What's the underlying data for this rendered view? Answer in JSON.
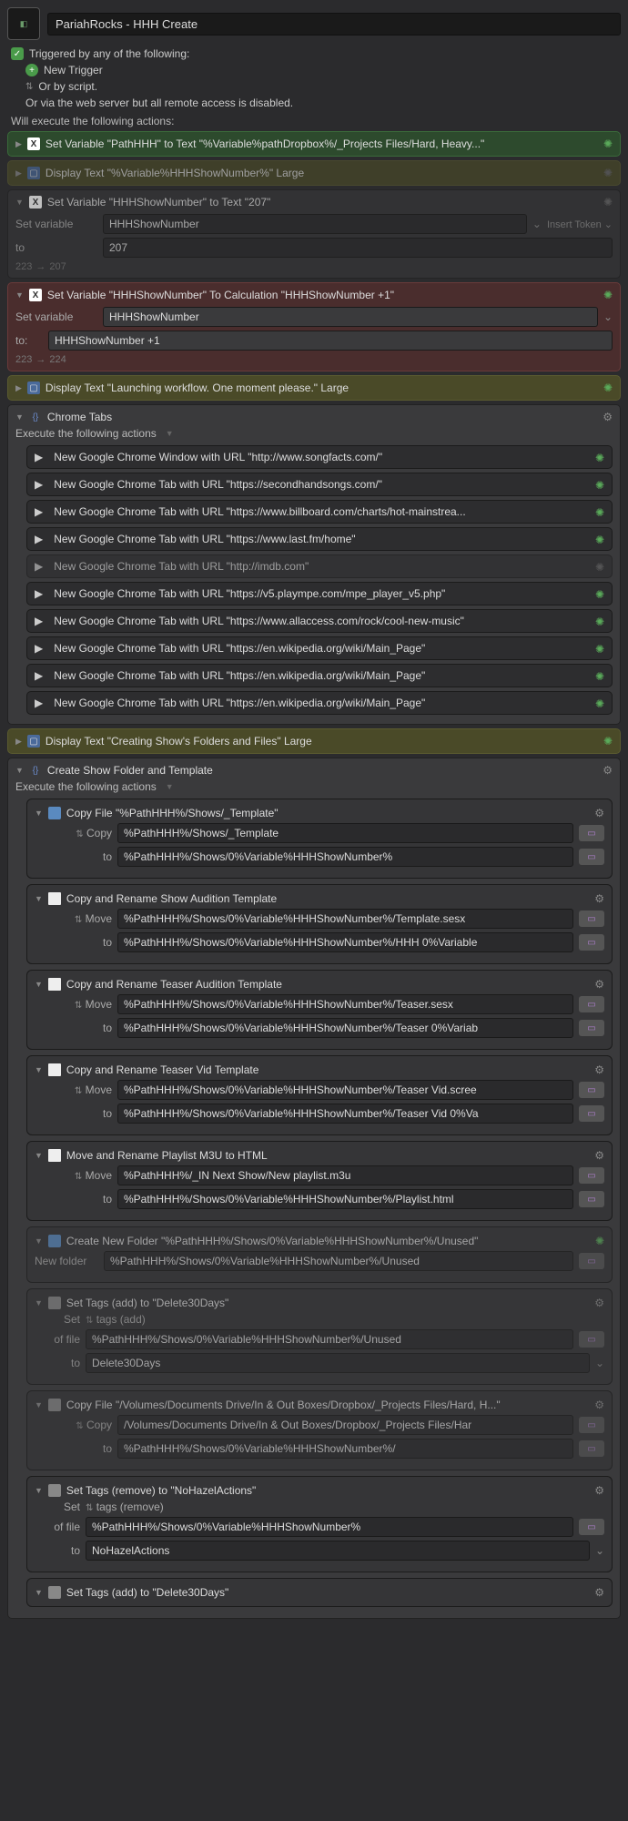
{
  "header": {
    "title": "PariahRocks - HHH Create"
  },
  "trigger": {
    "line": "Triggered by any of the following:",
    "new_trigger": "New Trigger",
    "or_script": "Or by script.",
    "web_server": "Or via the web server but all remote access is disabled."
  },
  "exec_label": "Will execute the following actions:",
  "a1": {
    "text": "Set Variable \"PathHHH\" to Text \"%Variable%pathDropbox%/_Projects Files/Hard, Heavy...\""
  },
  "a2": {
    "text": "Display Text \"%Variable%HHHShowNumber%\" Large"
  },
  "a3": {
    "title": "Set Variable \"HHHShowNumber\" to Text \"207\"",
    "set_var_label": "Set variable",
    "set_var_value": "HHHShowNumber",
    "insert_token": "Insert Token",
    "to_label": "to",
    "to_value": "207",
    "preview_from": "223",
    "preview_to": "207"
  },
  "a4": {
    "title": "Set Variable \"HHHShowNumber\" To Calculation \"HHHShowNumber +1\"",
    "set_var_label": "Set variable",
    "set_var_value": "HHHShowNumber",
    "to_label": "to:",
    "to_value": "HHHShowNumber +1",
    "preview_from": "223",
    "preview_to": "224"
  },
  "a5": {
    "text": "Display Text \"Launching workflow. One moment please.\" Large"
  },
  "chrome": {
    "title": "Chrome Tabs",
    "sub": "Execute the following actions",
    "items": [
      {
        "label": "New Google Chrome Window with URL \"http://www.songfacts.com/\"",
        "dim": false
      },
      {
        "label": "New Google Chrome Tab with URL \"https://secondhandsongs.com/\"",
        "dim": false
      },
      {
        "label": "New Google Chrome Tab with URL \"https://www.billboard.com/charts/hot-mainstrea...",
        "dim": false
      },
      {
        "label": "New Google Chrome Tab with URL \"https://www.last.fm/home\"",
        "dim": false
      },
      {
        "label": "New Google Chrome Tab with URL \"http://imdb.com\"",
        "dim": true
      },
      {
        "label": "New Google Chrome Tab with URL \"https://v5.plaympe.com/mpe_player_v5.php\"",
        "dim": false
      },
      {
        "label": "New Google Chrome Tab with URL \"https://www.allaccess.com/rock/cool-new-music\"",
        "dim": false
      },
      {
        "label": "New Google Chrome Tab with URL \"https://en.wikipedia.org/wiki/Main_Page\"",
        "dim": false
      },
      {
        "label": "New Google Chrome Tab with URL \"https://en.wikipedia.org/wiki/Main_Page\"",
        "dim": false
      },
      {
        "label": "New Google Chrome Tab with URL \"https://en.wikipedia.org/wiki/Main_Page\"",
        "dim": false
      }
    ]
  },
  "a7": {
    "text": "Display Text \"Creating Show's Folders and Files\" Large"
  },
  "folder": {
    "title": "Create Show Folder and Template",
    "sub": "Execute the following actions"
  },
  "f1": {
    "title": "Copy File \"%PathHHH%/Shows/_Template\"",
    "op": "Copy",
    "from": "%PathHHH%/Shows/_Template",
    "to_label": "to",
    "to": "%PathHHH%/Shows/0%Variable%HHHShowNumber%"
  },
  "f2": {
    "title": "Copy and Rename Show Audition Template",
    "op": "Move",
    "from": "%PathHHH%/Shows/0%Variable%HHHShowNumber%/Template.sesx",
    "to_label": "to",
    "to": "%PathHHH%/Shows/0%Variable%HHHShowNumber%/HHH 0%Variable"
  },
  "f3": {
    "title": "Copy and Rename Teaser Audition Template",
    "op": "Move",
    "from": "%PathHHH%/Shows/0%Variable%HHHShowNumber%/Teaser.sesx",
    "to_label": "to",
    "to": "%PathHHH%/Shows/0%Variable%HHHShowNumber%/Teaser 0%Variab"
  },
  "f4": {
    "title": "Copy and Rename Teaser Vid Template",
    "op": "Move",
    "from": "%PathHHH%/Shows/0%Variable%HHHShowNumber%/Teaser Vid.scree",
    "to_label": "to",
    "to": "%PathHHH%/Shows/0%Variable%HHHShowNumber%/Teaser Vid 0%Va"
  },
  "f5": {
    "title": "Move and Rename Playlist M3U to HTML",
    "op": "Move",
    "from": "%PathHHH%/_IN Next Show/New playlist.m3u",
    "to_label": "to",
    "to": "%PathHHH%/Shows/0%Variable%HHHShowNumber%/Playlist.html"
  },
  "f6": {
    "title": "Create New Folder \"%PathHHH%/Shows/0%Variable%HHHShowNumber%/Unused\"",
    "lbl": "New folder",
    "val": "%PathHHH%/Shows/0%Variable%HHHShowNumber%/Unused"
  },
  "f7": {
    "title": "Set Tags (add) to \"Delete30Days\"",
    "set": "Set",
    "tags": "tags (add)",
    "of_file": "of file",
    "file": "%PathHHH%/Shows/0%Variable%HHHShowNumber%/Unused",
    "to_label": "to",
    "to": "Delete30Days"
  },
  "f8": {
    "title": "Copy File \"/Volumes/Documents Drive/In & Out Boxes/Dropbox/_Projects Files/Hard, H...\"",
    "op": "Copy",
    "from": "/Volumes/Documents Drive/In & Out Boxes/Dropbox/_Projects Files/Har",
    "to_label": "to",
    "to": "%PathHHH%/Shows/0%Variable%HHHShowNumber%/"
  },
  "f9": {
    "title": "Set Tags (remove) to \"NoHazelActions\"",
    "set": "Set",
    "tags": "tags (remove)",
    "of_file": "of file",
    "file": "%PathHHH%/Shows/0%Variable%HHHShowNumber%",
    "to_label": "to",
    "to": "NoHazelActions"
  },
  "f10": {
    "title": "Set Tags (add) to \"Delete30Days\""
  }
}
